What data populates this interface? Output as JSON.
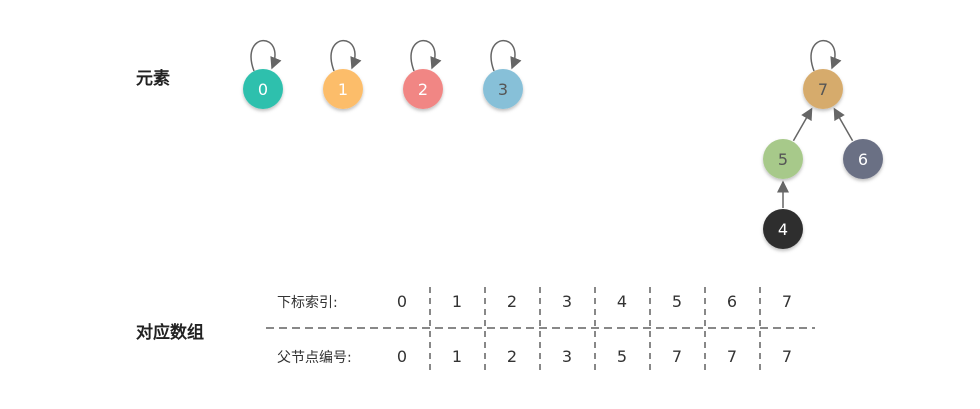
{
  "labels": {
    "elements": "元素",
    "array": "对应数组",
    "index_row": "下标索引:",
    "parent_row": "父节点编号:"
  },
  "nodes": [
    {
      "id": "0",
      "color": "#2fc0ad",
      "text_color": "#ffffff",
      "self_loop": true
    },
    {
      "id": "1",
      "color": "#fcbd6b",
      "text_color": "#ffffff",
      "self_loop": true
    },
    {
      "id": "2",
      "color": "#f18684",
      "text_color": "#ffffff",
      "self_loop": true
    },
    {
      "id": "3",
      "color": "#87c0d8",
      "text_color": "#555555",
      "self_loop": true
    },
    {
      "id": "7",
      "color": "#d6ab6c",
      "text_color": "#555555",
      "self_loop": true
    },
    {
      "id": "5",
      "color": "#a7c98a",
      "text_color": "#555555",
      "self_loop": false
    },
    {
      "id": "6",
      "color": "#6b6f84",
      "text_color": "#ffffff",
      "self_loop": false
    },
    {
      "id": "4",
      "color": "#2f2f2f",
      "text_color": "#ffffff",
      "self_loop": false
    }
  ],
  "edges": [
    {
      "from": "5",
      "to": "7"
    },
    {
      "from": "6",
      "to": "7"
    },
    {
      "from": "4",
      "to": "5"
    }
  ],
  "array": {
    "indices": [
      "0",
      "1",
      "2",
      "3",
      "4",
      "5",
      "6",
      "7"
    ],
    "parents": [
      "0",
      "1",
      "2",
      "3",
      "5",
      "7",
      "7",
      "7"
    ]
  }
}
